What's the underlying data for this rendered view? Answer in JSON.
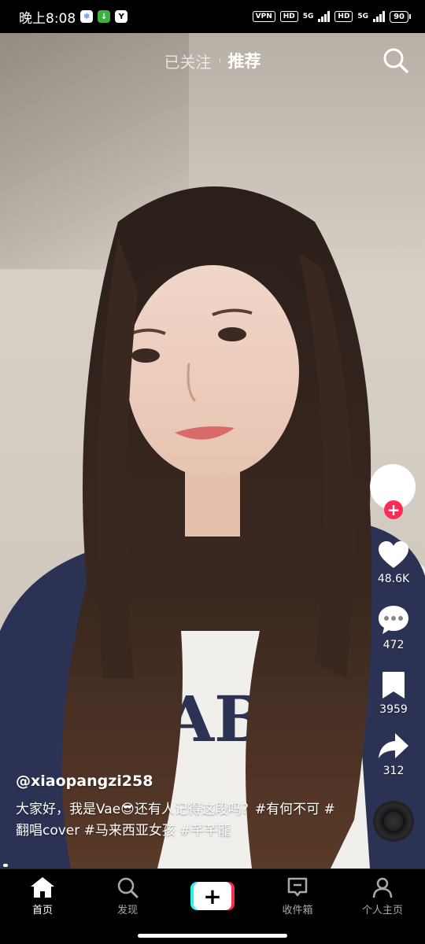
{
  "status_bar": {
    "time": "晚上8:08",
    "vpn": "VPN",
    "hd1": "HD",
    "net1": "5G",
    "hd2": "HD",
    "net2": "5G",
    "battery": "90"
  },
  "top_tabs": {
    "following": "已关注",
    "recommend": "推荐"
  },
  "actions": {
    "likes": "48.6K",
    "comments": "472",
    "favorites": "3959",
    "shares": "312"
  },
  "caption": {
    "username": "@xiaopangzi258",
    "description": "大家好，我是Vae😎还有人记得这段吗？#有何不可 #翻唱cover #马来西亚女孩 #芊芊龍"
  },
  "bottom_nav": {
    "home": "首页",
    "discover": "发现",
    "create": "+",
    "inbox": "收件箱",
    "profile": "个人主页"
  },
  "colors": {
    "accent_red": "#fe2c55",
    "accent_cyan": "#25f4ee"
  }
}
